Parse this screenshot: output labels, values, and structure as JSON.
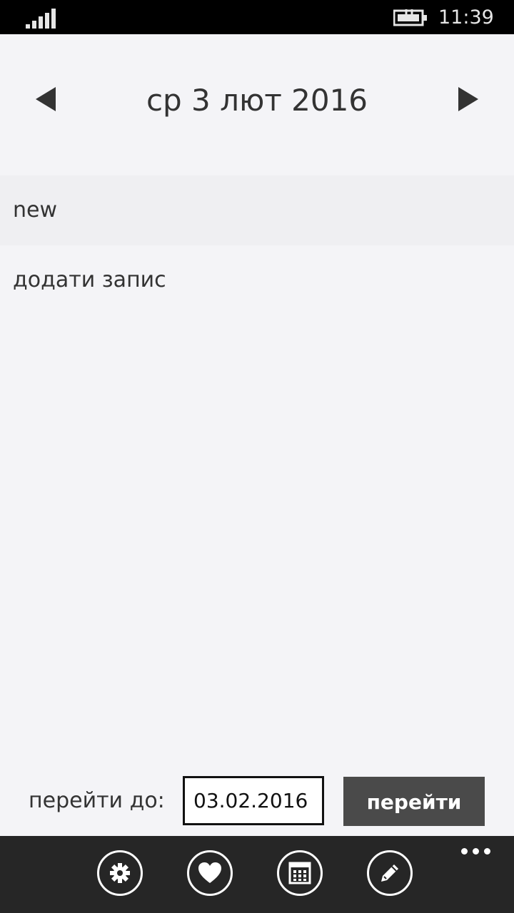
{
  "status_bar": {
    "time": "11:39",
    "signal_icon": "signal-bars-icon",
    "battery_icon": "battery-charging-icon"
  },
  "header": {
    "date": "ср 3 лют 2016",
    "prev_icon": "triangle-left-icon",
    "next_icon": "triangle-right-icon"
  },
  "entries": [
    {
      "title": "new"
    }
  ],
  "add_entry_label": "додати запис",
  "goto": {
    "label": "перейти до:",
    "value": "03.02.2016",
    "button_label": "перейти"
  },
  "app_bar": {
    "buttons": [
      "gear-icon",
      "heart-icon",
      "calendar-icon",
      "pencil-icon"
    ],
    "more_icon": "ellipsis-icon"
  },
  "colors": {
    "background": "#f4f4f7",
    "selected_row": "#efeff2",
    "app_bar": "#262626",
    "goto_button": "#4a4a4a"
  }
}
